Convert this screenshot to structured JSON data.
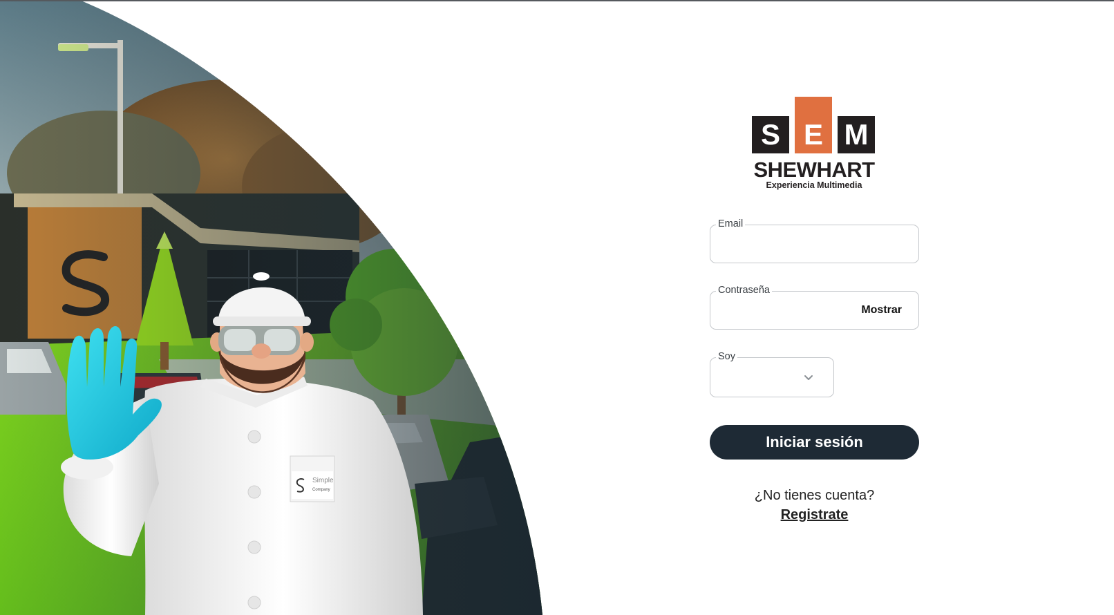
{
  "logo": {
    "letters": [
      "S",
      "E",
      "M"
    ],
    "wordmark": "SHEWHART",
    "tagline": "Experiencia Multimedia",
    "colors": {
      "dark": "#231f20",
      "accent": "#e07040"
    }
  },
  "hero": {
    "badge_text": [
      "Simple",
      "Company"
    ],
    "icon": "waving-engineer-illustration"
  },
  "form": {
    "email": {
      "label": "Email",
      "value": "",
      "placeholder": ""
    },
    "password": {
      "label": "Contraseña",
      "value": "",
      "placeholder": "",
      "show_label": "Mostrar"
    },
    "role": {
      "label": "Soy",
      "selected": "",
      "icon": "chevron-down-icon"
    },
    "submit_label": "Iniciar sesión"
  },
  "signup": {
    "question": "¿No tienes cuenta?",
    "link_label": "Registrate"
  },
  "colors": {
    "button_bg": "#1e2a35",
    "field_border": "#c4c7cb"
  }
}
